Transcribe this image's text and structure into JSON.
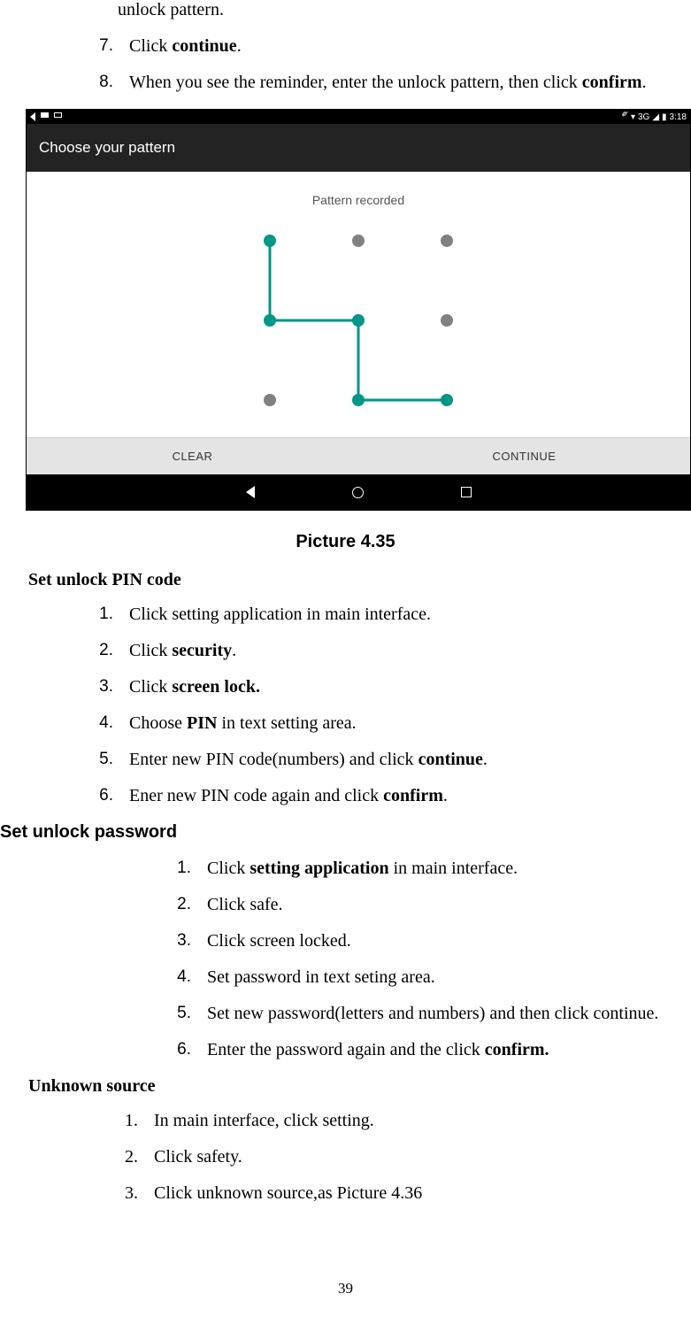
{
  "fragment_top": "unlock pattern.",
  "cont_list": [
    {
      "n": "7.",
      "pre": "Click ",
      "bold": "continue",
      "post": "."
    },
    {
      "n": "8.",
      "pre": "When you see the reminder, enter the unlock pattern, then click ",
      "bold": "confirm",
      "post": "."
    }
  ],
  "phone": {
    "status_time": "3:18",
    "status_net": "3G",
    "title": "Choose your pattern",
    "recorded": "Pattern recorded",
    "clear": "CLEAR",
    "continue": "CONTINUE"
  },
  "caption": "Picture 4.35",
  "section_pin": "Set unlock PIN code",
  "pin_list": [
    {
      "n": "1.",
      "text": "Click setting application in main interface."
    },
    {
      "n": "2.",
      "pre": "Click ",
      "bold": "security",
      "post": "."
    },
    {
      "n": "3.",
      "pre": "Click ",
      "bold": "screen lock.",
      "post": ""
    },
    {
      "n": "4.",
      "pre": "Choose ",
      "bold": "PIN",
      "post": " in text setting area."
    },
    {
      "n": "5.",
      "pre": "Enter new PIN code(numbers) and click ",
      "bold": "continue",
      "post": "."
    },
    {
      "n": "6.",
      "pre": "Ener new PIN code again and click ",
      "bold": "confirm",
      "post": "."
    }
  ],
  "section_pwd": "Set unlock password",
  "pwd_list": [
    {
      "n": "1.",
      "pre": "Click ",
      "bold": "setting application",
      "post": " in main interface."
    },
    {
      "n": "2.",
      "text": "Click safe."
    },
    {
      "n": "3.",
      "text": "Click screen locked."
    },
    {
      "n": "4.",
      "text": "Set password in text seting area."
    },
    {
      "n": "5.",
      "text": "Set new password(letters and numbers) and then click continue."
    },
    {
      "n": "6.",
      "pre": "Enter the password again and the click ",
      "bold": "confirm.",
      "post": ""
    }
  ],
  "section_unknown": "Unknown source",
  "unknown_list": [
    {
      "n": "1.",
      "text": "In main interface, click setting."
    },
    {
      "n": "2.",
      "text": "Click safety."
    },
    {
      "n": "3.",
      "text": "Click unknown source,as Picture 4.36"
    }
  ],
  "page_number": "39"
}
